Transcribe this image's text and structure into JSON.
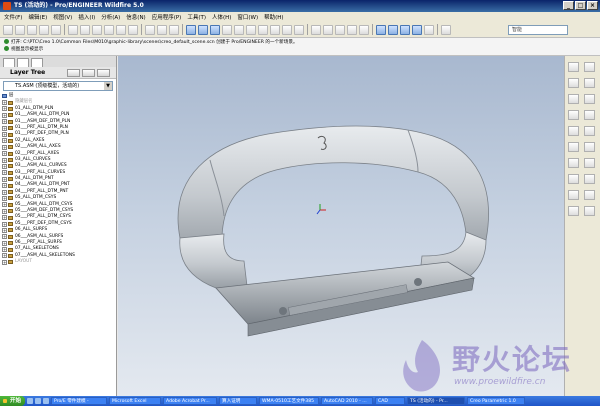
{
  "window": {
    "title": "TS (活动的) - Pro/ENGINEER Wildfire 5.0"
  },
  "menu": [
    "文件(F)",
    "编辑(E)",
    "视图(V)",
    "插入(I)",
    "分析(A)",
    "信息(N)",
    "应用程序(P)",
    "工具(T)",
    "人体(H)",
    "窗口(W)",
    "帮助(H)"
  ],
  "search": {
    "value": "智能"
  },
  "messages": [
    "打开: C:\\PTC\\Creo 1.0\\Common Files\\M010\\graphic-library\\scenes\\creo_default_scene.scn 创建于 Pro/ENGINEER 的一个新场景。",
    "视图显示被显示"
  ],
  "panel": {
    "tab_label": "Layer Tree",
    "combo_value": "TS.ASM (顶级模型，活动的)",
    "rows": [
      {
        "label": "层",
        "grey": false
      },
      {
        "label": "隐藏层名",
        "grey": true
      },
      {
        "label": "01_ALL_DTM_PLN",
        "grey": false
      },
      {
        "label": "01___ASM_ALL_DTM_PLN",
        "grey": false
      },
      {
        "label": "01___ASM_DEF_DTM_PLN",
        "grey": false
      },
      {
        "label": "01___PRT_ALL_DTM_PLN",
        "grey": false
      },
      {
        "label": "01___PRT_DEF_DTM_PLN",
        "grey": false
      },
      {
        "label": "02_ALL_AXES",
        "grey": false
      },
      {
        "label": "02___ASM_ALL_AXES",
        "grey": false
      },
      {
        "label": "02___PRT_ALL_AXES",
        "grey": false
      },
      {
        "label": "03_ALL_CURVES",
        "grey": false
      },
      {
        "label": "03___ASM_ALL_CURVES",
        "grey": false
      },
      {
        "label": "03___PRT_ALL_CURVES",
        "grey": false
      },
      {
        "label": "04_ALL_DTM_PNT",
        "grey": false
      },
      {
        "label": "04___ASM_ALL_DTM_PNT",
        "grey": false
      },
      {
        "label": "04___PRT_ALL_DTM_PNT",
        "grey": false
      },
      {
        "label": "05_ALL_DTM_CSYS",
        "grey": false
      },
      {
        "label": "05___ASM_ALL_DTM_CSYS",
        "grey": false
      },
      {
        "label": "05___ASM_DEF_DTM_CSYS",
        "grey": false
      },
      {
        "label": "05___PRT_ALL_DTM_CSYS",
        "grey": false
      },
      {
        "label": "05___PRT_DEF_DTM_CSYS",
        "grey": false
      },
      {
        "label": "06_ALL_SURFS",
        "grey": false
      },
      {
        "label": "06___ASM_ALL_SURFS",
        "grey": false
      },
      {
        "label": "06___PRT_ALL_SURFS",
        "grey": false
      },
      {
        "label": "07_ALL_SKELETONS",
        "grey": false
      },
      {
        "label": "07___ASM_ALL_SKELETONS",
        "grey": false
      },
      {
        "label": "LAYOUT",
        "grey": true
      }
    ]
  },
  "watermark": {
    "title": "野火论坛",
    "url": "www.proewildfire.cn"
  },
  "taskbar": {
    "start_label": "开始",
    "tasks": [
      "Pro/E 零件建模 -",
      "Microsoft Excel",
      "Adobe Acrobat Pr...",
      "算入证明",
      "WMA-0510工艺文件385",
      "AutoCAD 2010 - ...",
      "CAD",
      "TS (活动的) - Pr...",
      "Creo Parametric 1.0"
    ],
    "active_index": 7
  },
  "colors": {
    "title": "#0a246a",
    "viewport_top": "#a8b8cf",
    "viewport_bottom": "#e4e9f0",
    "model": "#c8cdd2"
  }
}
